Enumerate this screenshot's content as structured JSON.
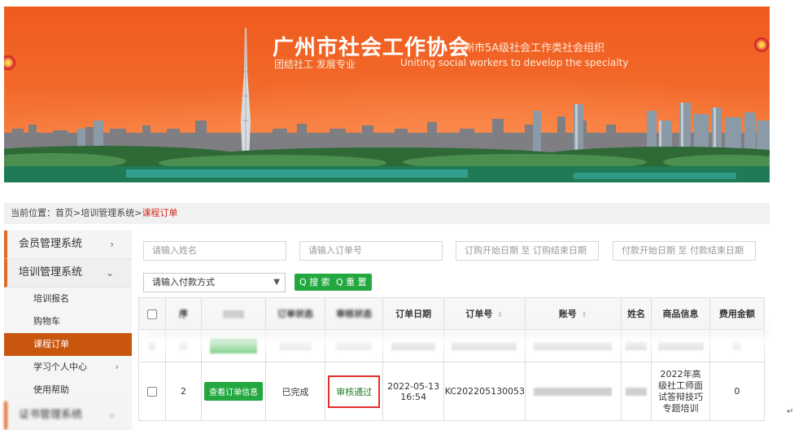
{
  "banner": {
    "title": "广州市社会工作协会",
    "subtitle": "广州市5A级社会工作类社会组织",
    "slogan_cn": "团结社工  发展专业",
    "slogan_en": "Uniting social workers to develop the specialty"
  },
  "breadcrumb": {
    "prefix": "当前位置：",
    "home": "首页",
    "sep1": " >",
    "system": "培训管理系统",
    "sep2": " >",
    "current": "课程订单"
  },
  "sidebar": {
    "groups": [
      {
        "label": "会员管理系统",
        "arrow": "›"
      },
      {
        "label": "培训管理系统",
        "arrow": "⌄"
      }
    ],
    "items": [
      {
        "label": "培训报名",
        "arrow": ""
      },
      {
        "label": "购物车",
        "arrow": ""
      },
      {
        "label": "课程订单",
        "arrow": ""
      },
      {
        "label": "学习个人中心",
        "arrow": "›"
      },
      {
        "label": "使用帮助",
        "arrow": ""
      }
    ],
    "next_group": {
      "label": "证书管理系统",
      "arrow": "›"
    }
  },
  "filters": {
    "name_placeholder": "请输入姓名",
    "order_placeholder": "请输入订单号",
    "order_date_range": "订购开始日期 至 订购结束日期",
    "pay_date_range": "付款开始日期 至 付款结束日期",
    "pay_method": "请输入付款方式",
    "search_btn": "Q 搜 索",
    "reset_btn": "Q 重 置"
  },
  "table": {
    "headers": [
      "",
      "序",
      "",
      "订单状态",
      "审核状态",
      "订单日期",
      "订单号",
      "账号",
      "姓名",
      "商品信息",
      "费用金额"
    ],
    "row2": {
      "index": "2",
      "view_btn": "查看订单信息",
      "order_status": "已完成",
      "audit_status": "审核通过",
      "date_line1": "2022-05-13",
      "date_line2": "16:54",
      "order_no": "KC202205130053",
      "product": "2022年高级社工师面试答辩技巧专题培训",
      "amount": "0"
    }
  },
  "colors": {
    "accent": "#e06a28",
    "green": "#23a840",
    "red": "#e0302e"
  }
}
